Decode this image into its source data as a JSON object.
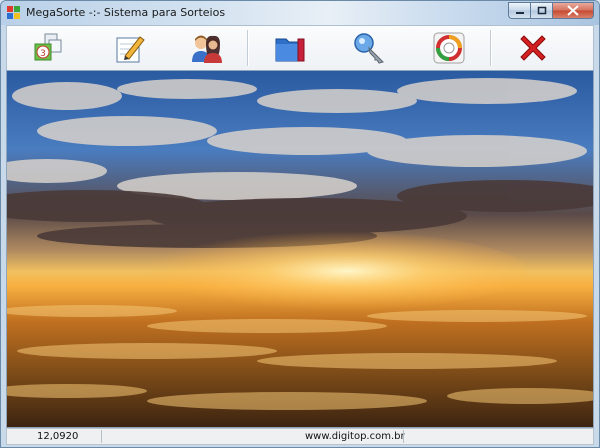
{
  "window": {
    "title": "MegaSorte -:- Sistema para Sorteios",
    "icon": "app-grid-icon",
    "controls": [
      "minimize-icon",
      "maximize-icon",
      "close-icon"
    ]
  },
  "toolbar": {
    "buttons": [
      {
        "icon": "lottery-numbers-icon"
      },
      {
        "icon": "edit-pencil-icon"
      },
      {
        "icon": "users-icon"
      },
      {
        "icon": "folder-icon"
      },
      {
        "icon": "key-icon"
      },
      {
        "icon": "lifebuoy-icon"
      },
      {
        "icon": "exit-x-icon"
      }
    ]
  },
  "content": {
    "image": "sunset-over-clouds-wallpaper"
  },
  "statusbar": {
    "value": "12,0920",
    "website": "www.digitop.com.br"
  },
  "colors": {
    "exit_red": "#d42020",
    "title_bar": "#bcd3ea"
  }
}
